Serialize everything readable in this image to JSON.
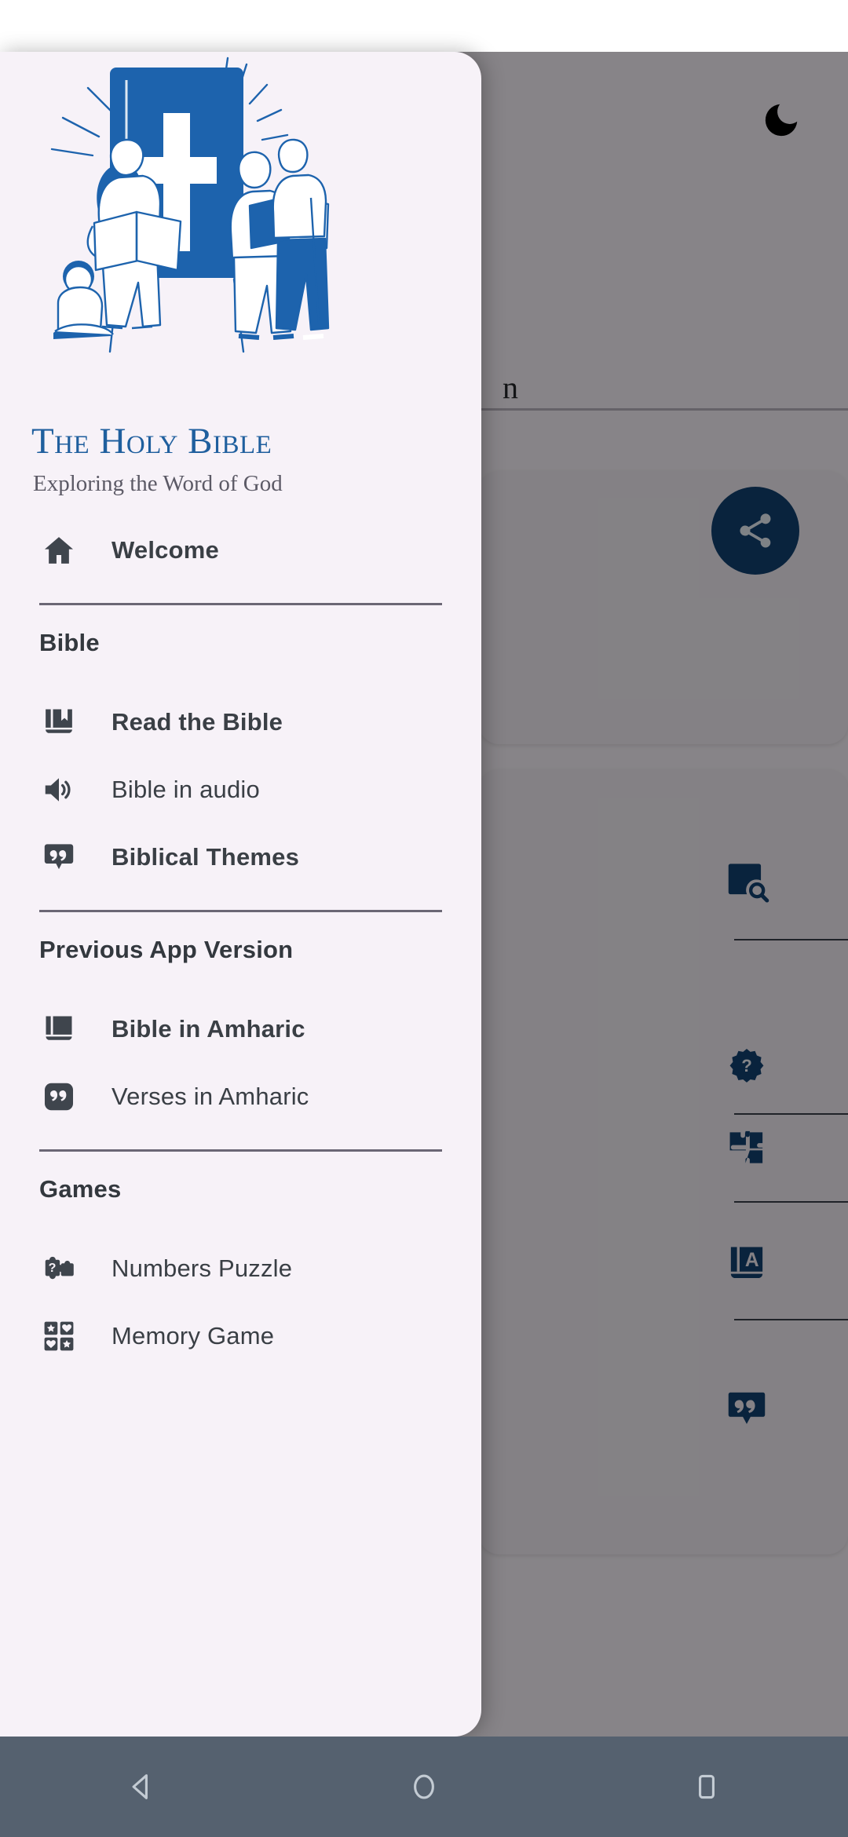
{
  "colors": {
    "brand_blue": "#1f5f9e",
    "illustration_blue": "#1d63ad",
    "drawer_bg": "#f7f2f8",
    "icon_dark": "#3f454d",
    "navbar": "#55616f",
    "accent_dark_blue": "#12406f"
  },
  "drawer": {
    "hero_illustration": "people-reading-bible-with-cross-illustration",
    "title": "The Holy Bible",
    "subtitle": "Exploring the Word of God",
    "items_top": [
      {
        "label": "Welcome",
        "icon": "home-icon",
        "bold": true
      }
    ],
    "sections": [
      {
        "label": "Bible",
        "items": [
          {
            "label": "Read the Bible",
            "icon": "menu-book-icon",
            "bold": true
          },
          {
            "label": "Bible in audio",
            "icon": "volume-up-icon",
            "bold": false
          },
          {
            "label": "Biblical Themes",
            "icon": "quote-bubble-icon",
            "bold": true
          }
        ]
      },
      {
        "label": "Previous App Version",
        "items": [
          {
            "label": "Bible in Amharic",
            "icon": "book-icon",
            "bold": true
          },
          {
            "label": "Verses in Amharic",
            "icon": "quote-square-icon",
            "bold": false
          }
        ]
      },
      {
        "label": "Games",
        "items": [
          {
            "label": "Numbers Puzzle",
            "icon": "puzzle-question-icon",
            "bold": false
          },
          {
            "label": "Memory Game",
            "icon": "memory-cards-icon",
            "bold": false
          }
        ]
      }
    ]
  },
  "background": {
    "dark_mode_icon": "moon-icon",
    "partial_title": "n",
    "share_button_icon": "share-icon",
    "tiles": [
      {
        "icon": "search-document-icon"
      },
      {
        "icon": "help-badge-icon"
      },
      {
        "icon": "puzzle-icon"
      },
      {
        "icon": "dictionary-icon"
      },
      {
        "icon": "quote-bubble-icon"
      }
    ]
  },
  "system_navbar": {
    "back": "back-triangle-icon",
    "home": "home-circle-icon",
    "recents": "recents-square-icon"
  }
}
